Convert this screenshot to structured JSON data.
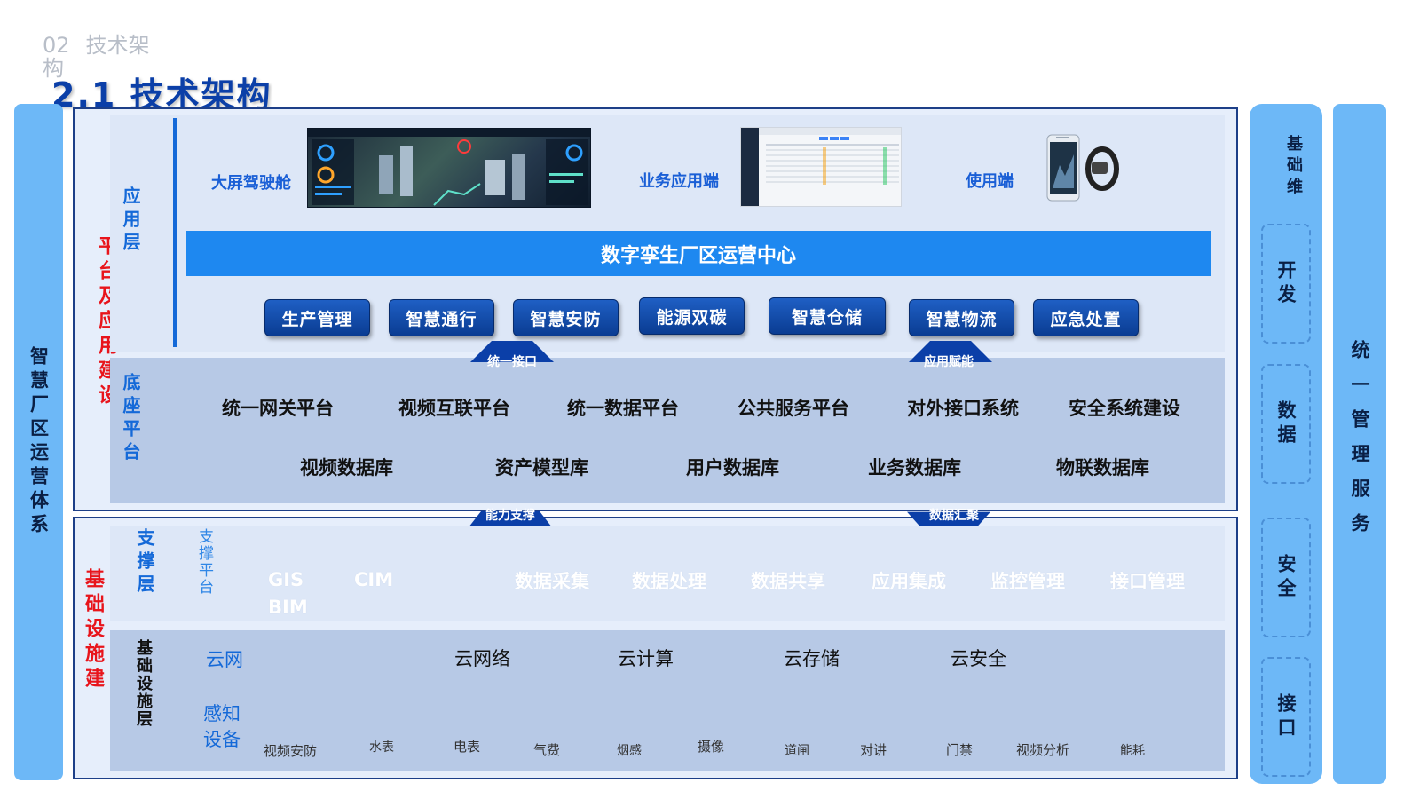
{
  "header": {
    "section_number": "02",
    "section_name": "技术架构",
    "title": "2.1 技术架构"
  },
  "left_bar": {
    "label": "智慧厂区运营体系"
  },
  "right_bar": {
    "label": "统一管理服务"
  },
  "ops_column": {
    "top_label": "基础维",
    "boxes": [
      "开发",
      "数据",
      "安全",
      "接口"
    ]
  },
  "groups": {
    "platform": "平台及应用建设",
    "infrastructure": "基础设施建"
  },
  "app_layer": {
    "label": "应用层",
    "terminals": [
      {
        "label": "大屏驾驶舱",
        "image": "dashboard-screenshot"
      },
      {
        "label": "业务应用端",
        "image": "web-app-screenshot"
      },
      {
        "label": "使用端",
        "image": "phone-and-wristband"
      }
    ],
    "center_band": "数字孪生厂区运营中心",
    "apps": [
      "生产管理",
      "智慧通行",
      "智慧安防",
      "能源双碳",
      "智慧仓储",
      "智慧物流",
      "应急处置"
    ]
  },
  "arrows": {
    "unified_interface": "统一接口",
    "app_enable": "应用赋能",
    "capability_support": "能力支撑",
    "data_aggregation": "数据汇聚"
  },
  "base_layer": {
    "label": "底座平台",
    "row1": [
      "统一网关平台",
      "视频互联平台",
      "统一数据平台",
      "公共服务平台",
      "对外接口系统",
      "安全系统建设"
    ],
    "row2": [
      "视频数据库",
      "资产模型库",
      "用户数据库",
      "业务数据库",
      "物联数据库"
    ]
  },
  "support_layer": {
    "label": "支撑层",
    "sub_label": "支撑平台",
    "items": [
      "GIS",
      "CIM",
      "BIM",
      "数据采集",
      "数据处理",
      "数据共享",
      "应用集成",
      "监控管理",
      "接口管理"
    ]
  },
  "infra_layer": {
    "label": "基础设施层",
    "cloud_label": "云网",
    "cloud_items": [
      "云网络",
      "云计算",
      "云存储",
      "云安全"
    ],
    "sense_label": "感知设备",
    "sense_items": [
      "视频安防",
      "水表",
      "电表",
      "气费",
      "烟感",
      "摄像",
      "道闸",
      "对讲",
      "门禁",
      "视频分析",
      "能耗"
    ]
  },
  "colors": {
    "title_blue": "#0b3fa8",
    "band_blue": "#1e88f0",
    "side_blue": "#6db8f7",
    "red_label": "#e8141b",
    "button_navy": "#0a3c92"
  }
}
